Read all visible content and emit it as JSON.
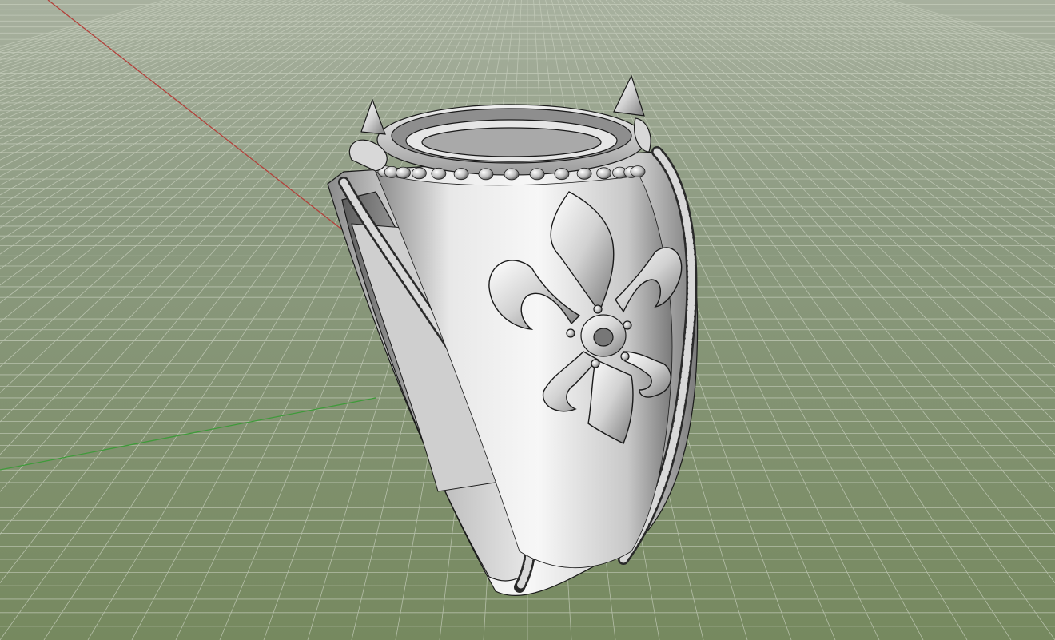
{
  "viewport": {
    "background_top": "#a8b19f",
    "background_horizon": "#8c9a80",
    "background_bottom": "#76895f",
    "grid_color": "#c9d0bf",
    "axis_x_color": "#b3403a",
    "axis_y_color": "#3f9a3a"
  },
  "model": {
    "material_light": "#f4f4f4",
    "material_mid": "#b9b9b9",
    "material_dark": "#6e6e6e",
    "edge_color": "#1a1a1a"
  }
}
